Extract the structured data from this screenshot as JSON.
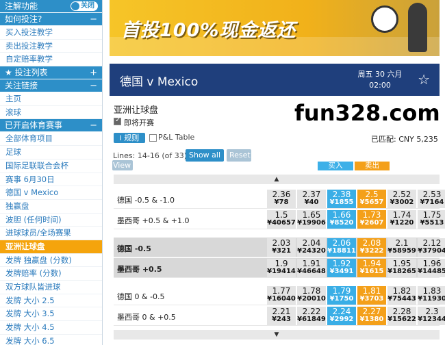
{
  "sidebar": {
    "top": {
      "label": "注解功能",
      "toggle": "关闭"
    },
    "how_to": {
      "label": "如何投注?",
      "sign": "−"
    },
    "how_items": [
      "买入投注教学",
      "卖出投注教学",
      "自定赔率教学"
    ],
    "bet_list": {
      "label": "★ 投注列表",
      "sign": "+"
    },
    "links": {
      "label": "关注链接",
      "sign": "−"
    },
    "link_items": [
      "主页",
      "滚球"
    ],
    "sports": {
      "label": "已开启体育赛事",
      "sign": "−"
    },
    "sport_items": [
      "全部体育项目",
      "足球",
      "国际足联联合会杯",
      "赛事 6月30日",
      "德国 v Mexico",
      "独赢盘",
      "波胆 (任何时间)",
      "进球球员/全场赛果",
      "亚洲让球盘",
      "发牌 独赢盘 (分数)",
      "发牌赔率 (分数)",
      "双方球队皆进球",
      "发牌 大小 2.5",
      "发牌 大小 3.5",
      "发牌 大小 4.5",
      "发牌 大小 6.5"
    ],
    "active_item": "亚洲让球盘"
  },
  "banner": {
    "text": "首投100%现金返还"
  },
  "match": {
    "title": "德国 v Mexico",
    "day": "周五 30 六月",
    "time": "02:00"
  },
  "market": {
    "title": "亚洲让球盘",
    "upcoming": "即将开赛",
    "rules": "i 规则",
    "pl_table": "P&L Table",
    "matched": "已匹配: CNY 5,235",
    "lines": "Lines: 14-16 (of 33)",
    "show_all": "Show all",
    "reset": "Reset",
    "view": "View",
    "buy": "买入",
    "sell": "卖出",
    "watermark": "fun328.com"
  },
  "rows": [
    {
      "label": "德国 -0.5 & -1.0",
      "cells": [
        [
          "2.36",
          "¥78"
        ],
        [
          "2.37",
          "¥40"
        ],
        [
          "2.38",
          "¥1855"
        ],
        [
          "2.5",
          "¥5657"
        ],
        [
          "2.52",
          "¥3002"
        ],
        [
          "2.53",
          "¥7164"
        ]
      ]
    },
    {
      "label": "墨西哥 +0.5 & +1.0",
      "cells": [
        [
          "1.5",
          "¥40657"
        ],
        [
          "1.65",
          "¥19906"
        ],
        [
          "1.66",
          "¥8520"
        ],
        [
          "1.73",
          "¥2607"
        ],
        [
          "1.74",
          "¥1220"
        ],
        [
          "1.75",
          "¥5513"
        ]
      ]
    },
    {
      "label": "德国 -0.5",
      "cells": [
        [
          "2.03",
          "¥321"
        ],
        [
          "2.04",
          "¥24320"
        ],
        [
          "2.06",
          "¥18811"
        ],
        [
          "2.08",
          "¥3222"
        ],
        [
          "2.1",
          "¥58959"
        ],
        [
          "2.12",
          "¥37904"
        ]
      ]
    },
    {
      "label": "墨西哥 +0.5",
      "cells": [
        [
          "1.9",
          "¥19414"
        ],
        [
          "1.91",
          "¥46648"
        ],
        [
          "1.92",
          "¥3491"
        ],
        [
          "1.94",
          "¥1615"
        ],
        [
          "1.95",
          "¥18265"
        ],
        [
          "1.96",
          "¥14485"
        ]
      ]
    },
    {
      "label": "德国 0 & -0.5",
      "cells": [
        [
          "1.77",
          "¥16040"
        ],
        [
          "1.78",
          "¥20010"
        ],
        [
          "1.79",
          "¥1750"
        ],
        [
          "1.81",
          "¥3703"
        ],
        [
          "1.82",
          "¥75443"
        ],
        [
          "1.83",
          "¥11930"
        ]
      ]
    },
    {
      "label": "墨西哥 0 & +0.5",
      "cells": [
        [
          "2.21",
          "¥243"
        ],
        [
          "2.22",
          "¥61849"
        ],
        [
          "2.24",
          "¥2992"
        ],
        [
          "2.27",
          "¥1380"
        ],
        [
          "2.28",
          "¥15622"
        ],
        [
          "2.3",
          "¥12344"
        ]
      ]
    }
  ]
}
